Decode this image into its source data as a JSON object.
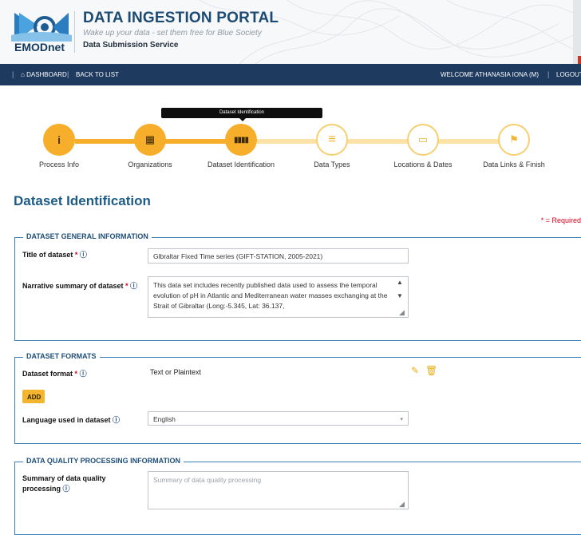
{
  "header": {
    "logo_text": "EMODnet",
    "title": "DATA INGESTION PORTAL",
    "tagline": "Wake up your data - set them free for Blue Society",
    "service": "Data Submission Service"
  },
  "nav": {
    "dashboard": "DASHBOARD",
    "back": "BACK TO LIST",
    "welcome": "WELCOME ATHANASIA IONA (M)",
    "logout": "LOGOUT"
  },
  "wizard": {
    "tooltip": "Dataset Identification",
    "steps": [
      {
        "label": "Process Info",
        "icon": "info-icon",
        "glyph": "i",
        "state": "done"
      },
      {
        "label": "Organizations",
        "icon": "building-icon",
        "glyph": "▦",
        "state": "done"
      },
      {
        "label": "Dataset Identification",
        "icon": "barcode-icon",
        "glyph": "▮▮▮",
        "state": "current"
      },
      {
        "label": "Data Types",
        "icon": "list-icon",
        "glyph": "≡",
        "state": "todo"
      },
      {
        "label": "Locations & Dates",
        "icon": "map-icon",
        "glyph": "▭",
        "state": "todo"
      },
      {
        "label": "Data Links & Finish",
        "icon": "flag-icon",
        "glyph": "⚑",
        "state": "todo"
      }
    ]
  },
  "page": {
    "heading": "Dataset Identification",
    "required_note": "* = Required"
  },
  "general": {
    "legend": "DATASET GENERAL INFORMATION",
    "title_label": "Title of dataset",
    "title_value": "Glbraltar Fixed Time series (GIFT-STATION, 2005-2021)",
    "summary_label": "Narrative summary of dataset",
    "summary_value": "This data set includes recently published data used to assess the temporal evolution of pH in Atlantic and Mediterranean water masses exchanging at the Strait of Gibraltar (Long:-5.345, Lat: 36.137,"
  },
  "formats": {
    "legend": "DATASET FORMATS",
    "format_label": "Dataset format",
    "format_value": "Text or Plaintext",
    "add_label": "ADD",
    "language_label": "Language used in dataset",
    "language_value": "English"
  },
  "quality": {
    "legend": "DATA QUALITY PROCESSING INFORMATION",
    "summary_label_1": "Summary of data quality",
    "summary_label_2": "processing",
    "summary_placeholder": "Summary of data quality processing"
  },
  "colors": {
    "accent": "#f7ae2b",
    "nav": "#1f3a5f",
    "heading": "#1d5c87",
    "required": "#d0021b"
  }
}
